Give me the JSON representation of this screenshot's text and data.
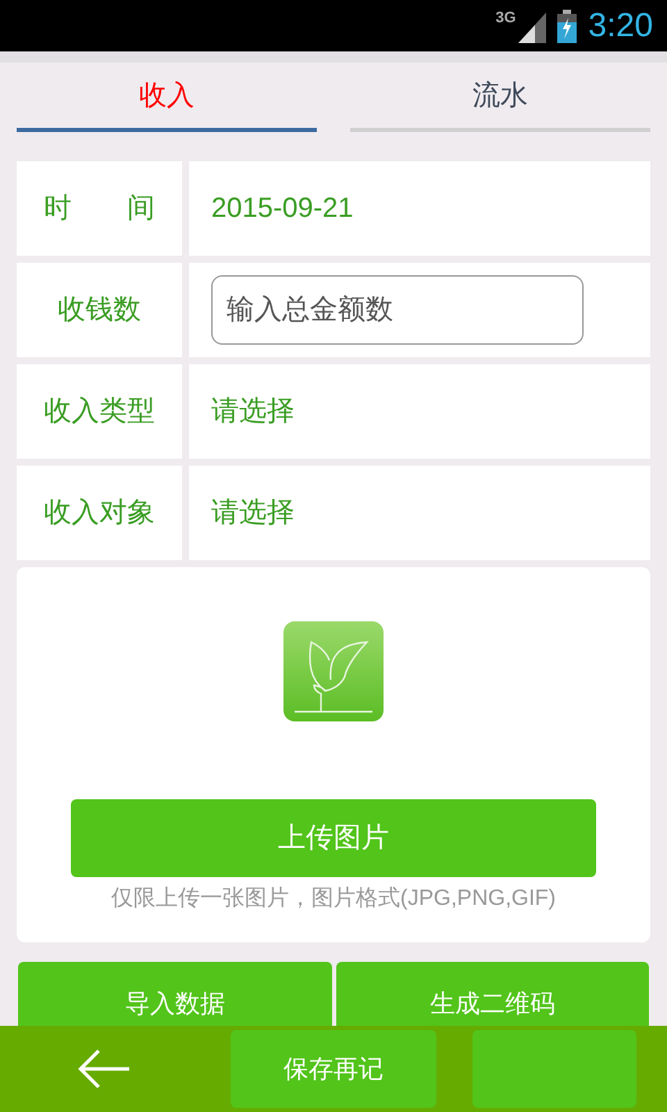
{
  "status_bar": {
    "network": "3G",
    "time": "3:20"
  },
  "tabs": [
    {
      "label": "收入",
      "selected": true
    },
    {
      "label": "流水",
      "selected": false
    }
  ],
  "form_rows": [
    {
      "kind": "text",
      "label": "时　　间",
      "value": "2015-09-21"
    },
    {
      "kind": "input",
      "label": "收钱数",
      "placeholder": "输入总金额数"
    },
    {
      "kind": "text",
      "label": "收入类型",
      "value": "请选择"
    },
    {
      "kind": "text",
      "label": "收入对象",
      "value": "请选择"
    }
  ],
  "upload": {
    "button": "上传图片",
    "hint": "仅限上传一张图片，图片格式(JPG,PNG,GIF)"
  },
  "action_buttons": [
    "导入数据",
    "生成二维码"
  ],
  "bottom_bar": {
    "save_button": "保存再记"
  }
}
